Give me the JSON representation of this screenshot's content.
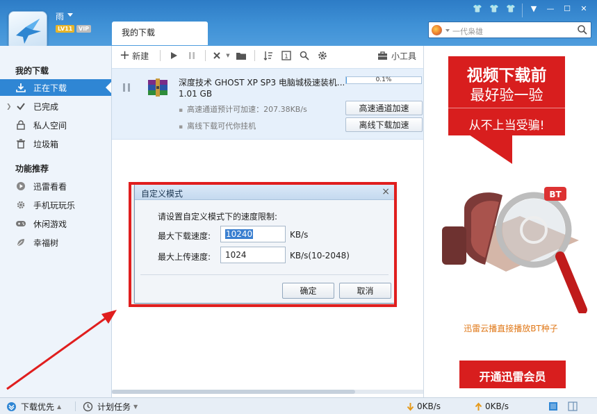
{
  "app": {
    "user_name": "雨",
    "level_badge": "LV11",
    "vip_badge": "VIP",
    "search_placeholder": "一代枭雄",
    "active_tab": "我的下载"
  },
  "sidebar": {
    "section_downloads": "我的下载",
    "items": [
      {
        "label": "正在下载",
        "icon": "download-icon",
        "active": true
      },
      {
        "label": "已完成",
        "icon": "checkmark-icon",
        "active": false
      },
      {
        "label": "私人空间",
        "icon": "lock-icon",
        "active": false
      },
      {
        "label": "垃圾箱",
        "icon": "trash-icon",
        "active": false
      }
    ],
    "section_features": "功能推荐",
    "features": [
      {
        "label": "迅雷看看",
        "icon": "play-circle-icon"
      },
      {
        "label": "手机玩玩乐",
        "icon": "gear-icon"
      },
      {
        "label": "休闲游戏",
        "icon": "gamepad-icon"
      },
      {
        "label": "幸福树",
        "icon": "leaf-icon"
      }
    ]
  },
  "toolbar": {
    "new_label": "新建",
    "tools_label": "小工具"
  },
  "task": {
    "name": "深度技术 GHOST XP SP3 电脑城极速装机...",
    "size": "1.01 GB",
    "progress_text": "0.1%",
    "progress_value": 0.001,
    "line1": "高速通道预计可加速：207.38KB/s",
    "line2": "离线下载可代你挂机",
    "btn_fast": "高速通道加速",
    "btn_offline": "离线下载加速"
  },
  "dialog": {
    "title": "自定义模式",
    "prompt": "请设置自定义模式下的速度限制:",
    "download_label": "最大下载速度:",
    "download_value": "10240",
    "download_unit": "KB/s",
    "upload_label": "最大上传速度:",
    "upload_value": "1024",
    "upload_unit": "KB/s(10-2048)",
    "ok_label": "确定",
    "cancel_label": "取消",
    "close_glyph": "×"
  },
  "ad": {
    "line1": "视频下载前",
    "line2": "最好验一验",
    "line3": "从不上当受骗!",
    "caption": "迅雷云播直接播放BT种子",
    "bt_label": "BT",
    "vip_button": "开通迅雷会员"
  },
  "statusbar": {
    "priority_label": "下载优先",
    "schedule_label": "计划任务",
    "down_speed": "0KB/s",
    "up_speed": "0KB/s"
  },
  "colors": {
    "accent_blue": "#2f86d4",
    "highlight_red": "#e01e1e",
    "ad_red": "#d81e1e"
  }
}
